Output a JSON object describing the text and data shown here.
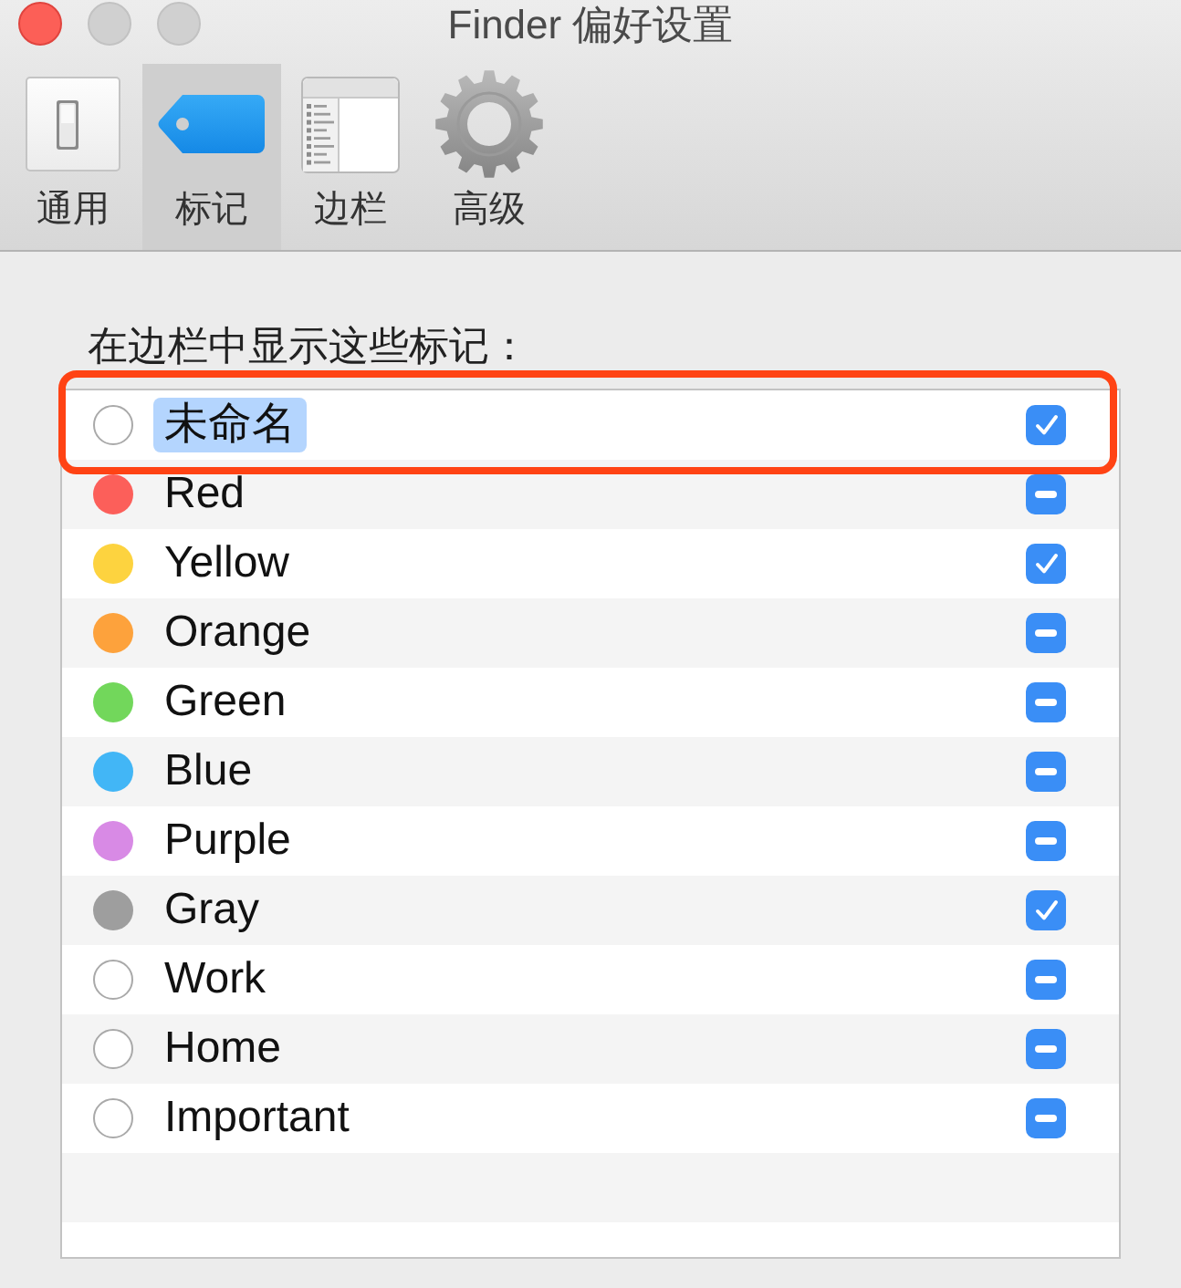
{
  "window": {
    "title": "Finder 偏好设置",
    "controls": [
      {
        "kind": "close",
        "disabled": false
      },
      {
        "kind": "minimize",
        "disabled": true
      },
      {
        "kind": "zoom",
        "disabled": true
      }
    ]
  },
  "toolbar": {
    "tabs": [
      {
        "label": "通用",
        "selected": false
      },
      {
        "label": "标记",
        "selected": true
      },
      {
        "label": "边栏",
        "selected": false
      },
      {
        "label": "高级",
        "selected": false
      }
    ]
  },
  "tags_panel": {
    "heading": "在边栏中显示这些标记：",
    "tags": [
      {
        "name": "未命名",
        "editing": true,
        "highlighted": true,
        "checked": true,
        "mixed": false
      },
      {
        "name": "Red",
        "color": "#fc5f5a",
        "editing": false,
        "highlighted": false,
        "checked": true,
        "mixed": true
      },
      {
        "name": "Yellow",
        "color": "#fdd33f",
        "editing": false,
        "highlighted": false,
        "checked": true,
        "mixed": false
      },
      {
        "name": "Orange",
        "color": "#fda23c",
        "editing": false,
        "highlighted": false,
        "checked": true,
        "mixed": true
      },
      {
        "name": "Green",
        "color": "#72d75b",
        "editing": false,
        "highlighted": false,
        "checked": true,
        "mixed": true
      },
      {
        "name": "Blue",
        "color": "#42b6f6",
        "editing": false,
        "highlighted": false,
        "checked": true,
        "mixed": true
      },
      {
        "name": "Purple",
        "color": "#d88ae5",
        "editing": false,
        "highlighted": false,
        "checked": true,
        "mixed": true
      },
      {
        "name": "Gray",
        "color": "#9e9e9e",
        "editing": false,
        "highlighted": false,
        "checked": true,
        "mixed": false
      },
      {
        "name": "Work",
        "editing": false,
        "highlighted": false,
        "checked": true,
        "mixed": true
      },
      {
        "name": "Home",
        "editing": false,
        "highlighted": false,
        "checked": true,
        "mixed": true
      },
      {
        "name": "Important",
        "editing": false,
        "highlighted": false,
        "checked": true,
        "mixed": true
      }
    ]
  }
}
